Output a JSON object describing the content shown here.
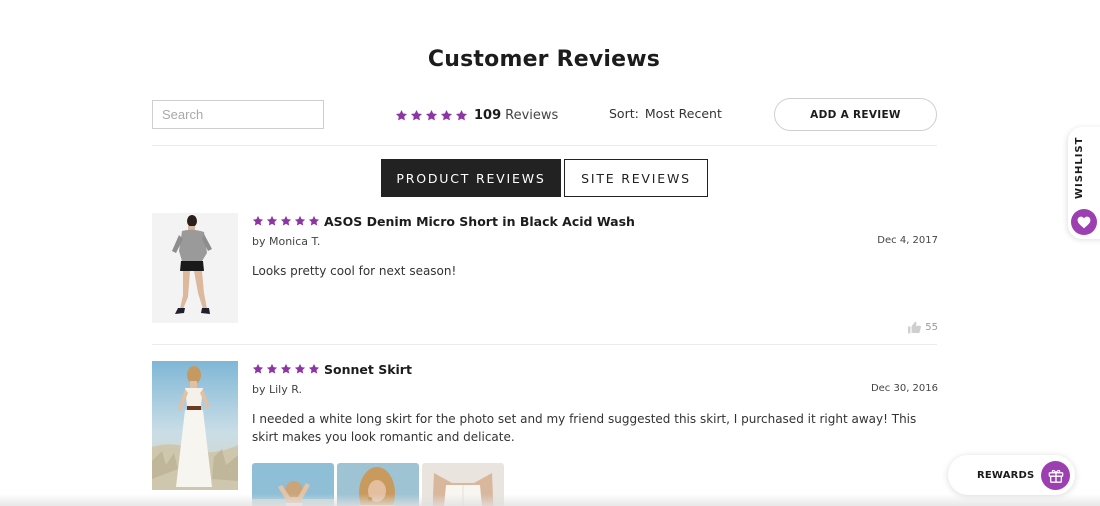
{
  "page": {
    "title": "Customer Reviews",
    "accent_color": "#9b3fb1"
  },
  "toolbar": {
    "search_placeholder": "Search",
    "rating_stars": 5,
    "review_count": "109",
    "review_count_label": "Reviews",
    "sort_label": "Sort:",
    "sort_value": "Most Recent",
    "add_review_label": "ADD A REVIEW"
  },
  "tabs": [
    {
      "label": "PRODUCT REVIEWS",
      "active": true
    },
    {
      "label": "SITE REVIEWS",
      "active": false
    }
  ],
  "reviews": [
    {
      "stars": 5,
      "product": "ASOS Denim Micro Short in Black Acid Wash",
      "author": "by Monica T.",
      "date": "Dec 4, 2017",
      "text": "Looks pretty cool for next season!",
      "likes": "55",
      "image_icon": "model-photo-denim-shorts"
    },
    {
      "stars": 5,
      "product": "Sonnet Skirt",
      "author": "by Lily R.",
      "date": "Dec 30, 2016",
      "text": "I needed a white long skirt for the photo set and my friend suggested this skirt, I purchased it right away! This skirt makes you look romantic and delicate.",
      "image_icon": "model-photo-white-skirt",
      "photo_count": 3
    }
  ],
  "wishlist": {
    "label": "WISHLIST",
    "icon": "heart-icon"
  },
  "rewards": {
    "label": "REWARDS",
    "icon": "gift-icon"
  }
}
